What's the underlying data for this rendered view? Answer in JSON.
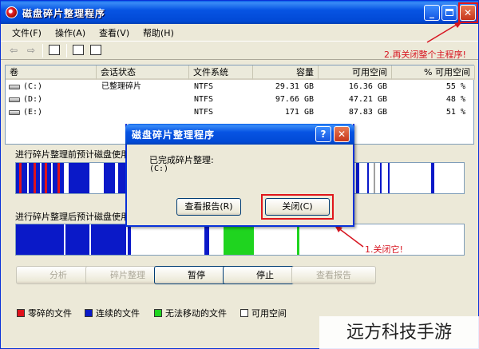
{
  "window": {
    "title": "磁盘碎片整理程序",
    "controls": [
      "minimize-icon",
      "maximize-icon",
      "close-icon"
    ]
  },
  "menu": [
    "文件(F)",
    "操作(A)",
    "查看(V)",
    "帮助(H)"
  ],
  "toolbar": [
    "back-arrow-icon",
    "forward-arrow-icon",
    "console-icon",
    "properties-icon",
    "help-icon"
  ],
  "annotations": {
    "top": "2.再关闭整个主程序!",
    "bottom": "1.关闭它!"
  },
  "list": {
    "columns": [
      "卷",
      "会话状态",
      "文件系统",
      "容量",
      "可用空间",
      "% 可用空间"
    ],
    "rows": [
      {
        "volume": "(C:)",
        "status": "已整理碎片",
        "fs": "NTFS",
        "capacity": "29.31 GB",
        "free": "16.36 GB",
        "pct": "55 %"
      },
      {
        "volume": "(D:)",
        "status": "",
        "fs": "NTFS",
        "capacity": "97.66 GB",
        "free": "47.21 GB",
        "pct": "48 %"
      },
      {
        "volume": "(E:)",
        "status": "",
        "fs": "NTFS",
        "capacity": "171 GB",
        "free": "87.83 GB",
        "pct": "51 %"
      }
    ]
  },
  "maps": {
    "before_label": "进行碎片整理前预计磁盘使用量:",
    "after_label": "进行碎片整理后预计磁盘使用量:"
  },
  "buttons": [
    {
      "label": "分析",
      "enabled": false
    },
    {
      "label": "碎片整理",
      "enabled": false
    },
    {
      "label": "暂停",
      "enabled": true
    },
    {
      "label": "停止",
      "enabled": true
    },
    {
      "label": "查看报告",
      "enabled": false
    }
  ],
  "legend": [
    {
      "label": "零碎的文件",
      "color": "#e0121b"
    },
    {
      "label": "连续的文件",
      "color": "#0a19c8"
    },
    {
      "label": "无法移动的文件",
      "color": "#1fd41f"
    },
    {
      "label": "可用空间",
      "color": "#ffffff"
    }
  ],
  "dialog": {
    "title": "磁盘碎片整理程序",
    "message": "已完成碎片整理:",
    "drive": "(C:)",
    "report_button": "查看报告(R)",
    "close_button": "关闭(C)"
  },
  "watermark": "远方科技手游",
  "colors": {
    "accent": "#0754e3",
    "annotation": "#e0161b",
    "fragmented": "#e0121b",
    "contiguous": "#0a19c8",
    "unmovable": "#1fd41f"
  }
}
